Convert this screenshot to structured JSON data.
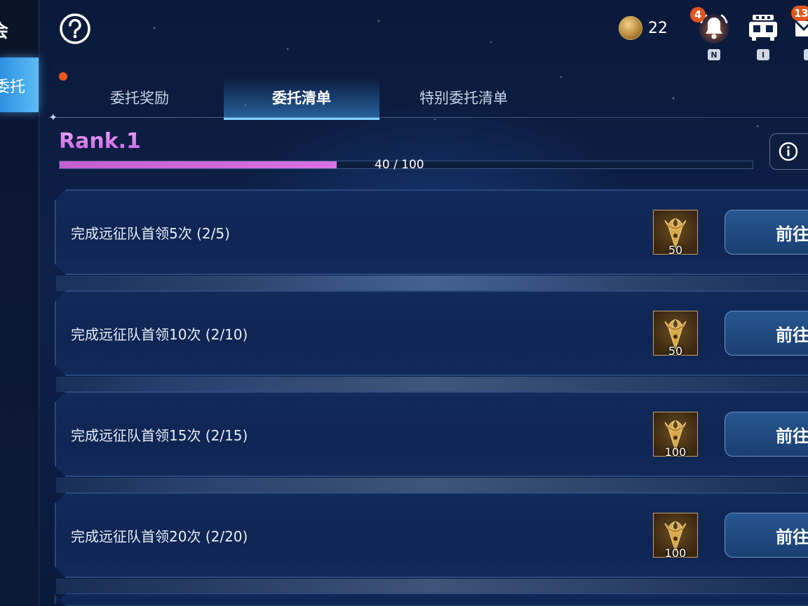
{
  "sidebar": {
    "top_label": "会",
    "active_item_label": "委托"
  },
  "topbar": {
    "currency_value": "22",
    "notifications": {
      "badge": "4",
      "hotkey": "N"
    },
    "inventory": {
      "hotkey": "I"
    },
    "mail": {
      "badge": "13"
    }
  },
  "tabs": [
    {
      "label": "委托奖励",
      "active": false
    },
    {
      "label": "委托清单",
      "active": true
    },
    {
      "label": "特别委托清单",
      "active": false
    }
  ],
  "rank": {
    "title": "Rank.1",
    "progress_text": "40 / 100",
    "progress": 0.4
  },
  "quests": [
    {
      "text": "完成远征队首领5次 (2/5)",
      "reward_qty": "50",
      "button": "前往"
    },
    {
      "text": "完成远征队首领10次 (2/10)",
      "reward_qty": "50",
      "button": "前往"
    },
    {
      "text": "完成远征队首领15次 (2/15)",
      "reward_qty": "100",
      "button": "前往"
    },
    {
      "text": "完成远征队首领20次 (2/20)",
      "reward_qty": "100",
      "button": "前往"
    }
  ]
}
